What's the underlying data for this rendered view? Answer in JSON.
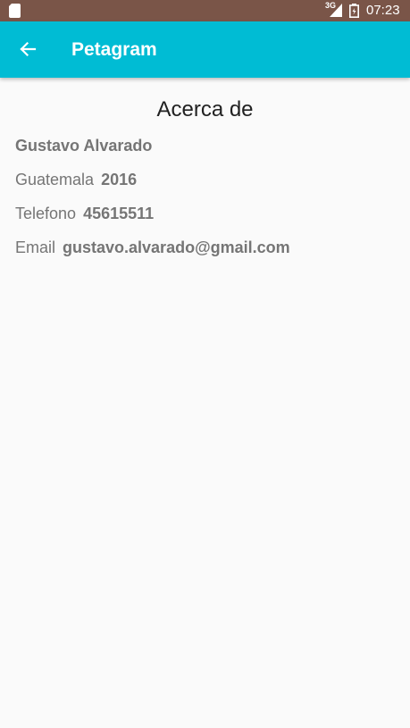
{
  "status_bar": {
    "network": "3G",
    "time": "07:23",
    "icons": [
      "sd-card-icon",
      "signal-icon",
      "battery-icon"
    ]
  },
  "app_bar": {
    "title": "Petagram",
    "back_icon": "arrow-back-icon",
    "color": "#00bcd4"
  },
  "about": {
    "title": "Acerca de",
    "name": "Gustavo Alvarado",
    "city_label": "Guatemala",
    "city_value": "2016",
    "phone_label": "Telefono",
    "phone_value": "45615511",
    "email_label": "Email",
    "email_value": "gustavo.alvarado@gmail.com"
  }
}
